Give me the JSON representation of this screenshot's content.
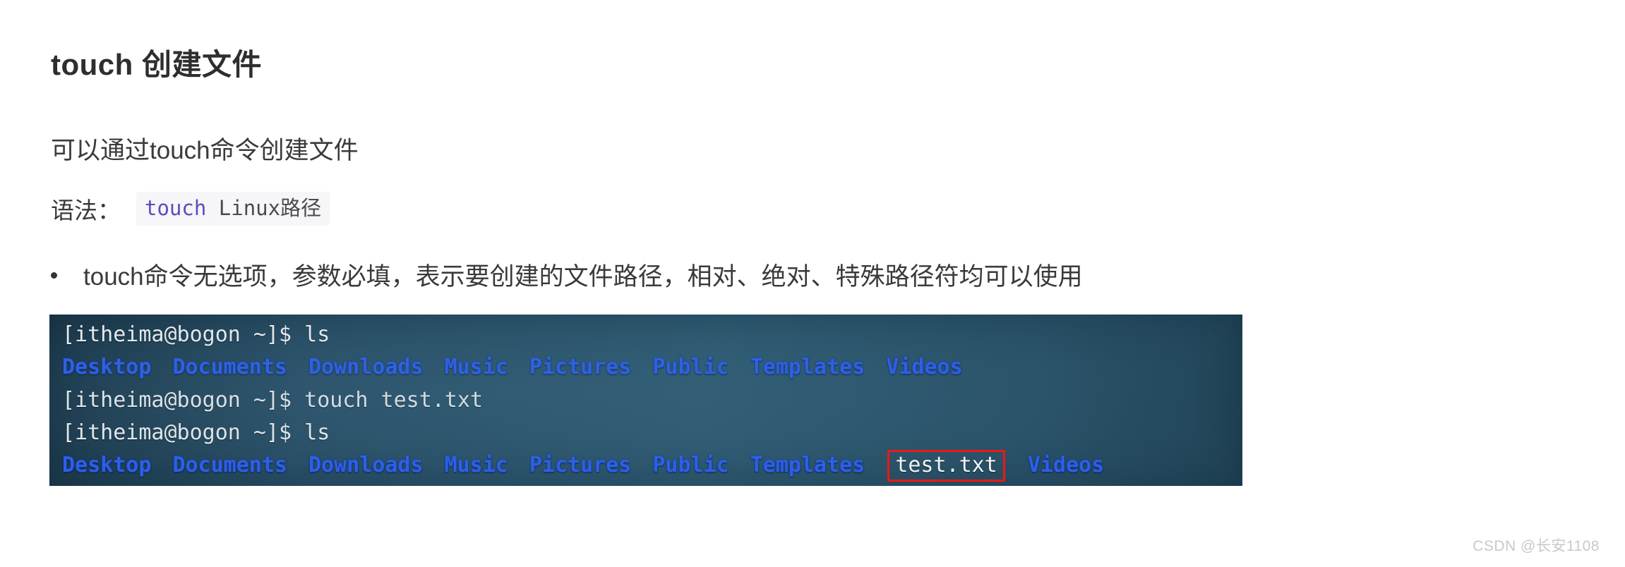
{
  "page": {
    "title": "touch 创建文件",
    "intro": "可以通过touch命令创建文件",
    "syntax": {
      "label": "语法：",
      "code_command": "touch",
      "code_argument": " Linux路径"
    },
    "bullet": {
      "text": "touch命令无选项，参数必填，表示要创建的文件路径，相对、绝对、特殊路径符均可以使用"
    },
    "watermark": "CSDN @长安1108"
  },
  "terminal": {
    "prompt": "[itheima@bogon ~]$ ",
    "lines": {
      "line1": "[itheima@bogon ~]$ ls",
      "line3": "[itheima@bogon ~]$ touch test.txt",
      "line4": "[itheima@bogon ~]$ ls"
    },
    "listing_first": [
      "Desktop",
      "Documents",
      "Downloads",
      "Music",
      "Pictures",
      "Public",
      "Templates",
      "Videos"
    ],
    "listing_second_dirs_before": [
      "Desktop",
      "Documents",
      "Downloads",
      "Music",
      "Pictures",
      "Public",
      "Templates"
    ],
    "listing_second_file": "test.txt",
    "listing_second_dirs_after": [
      "Videos"
    ],
    "colors": {
      "background": "#2a5068",
      "directory": "#2c5fe8",
      "text": "#e9eef0",
      "highlight_box": "#f01616"
    }
  }
}
